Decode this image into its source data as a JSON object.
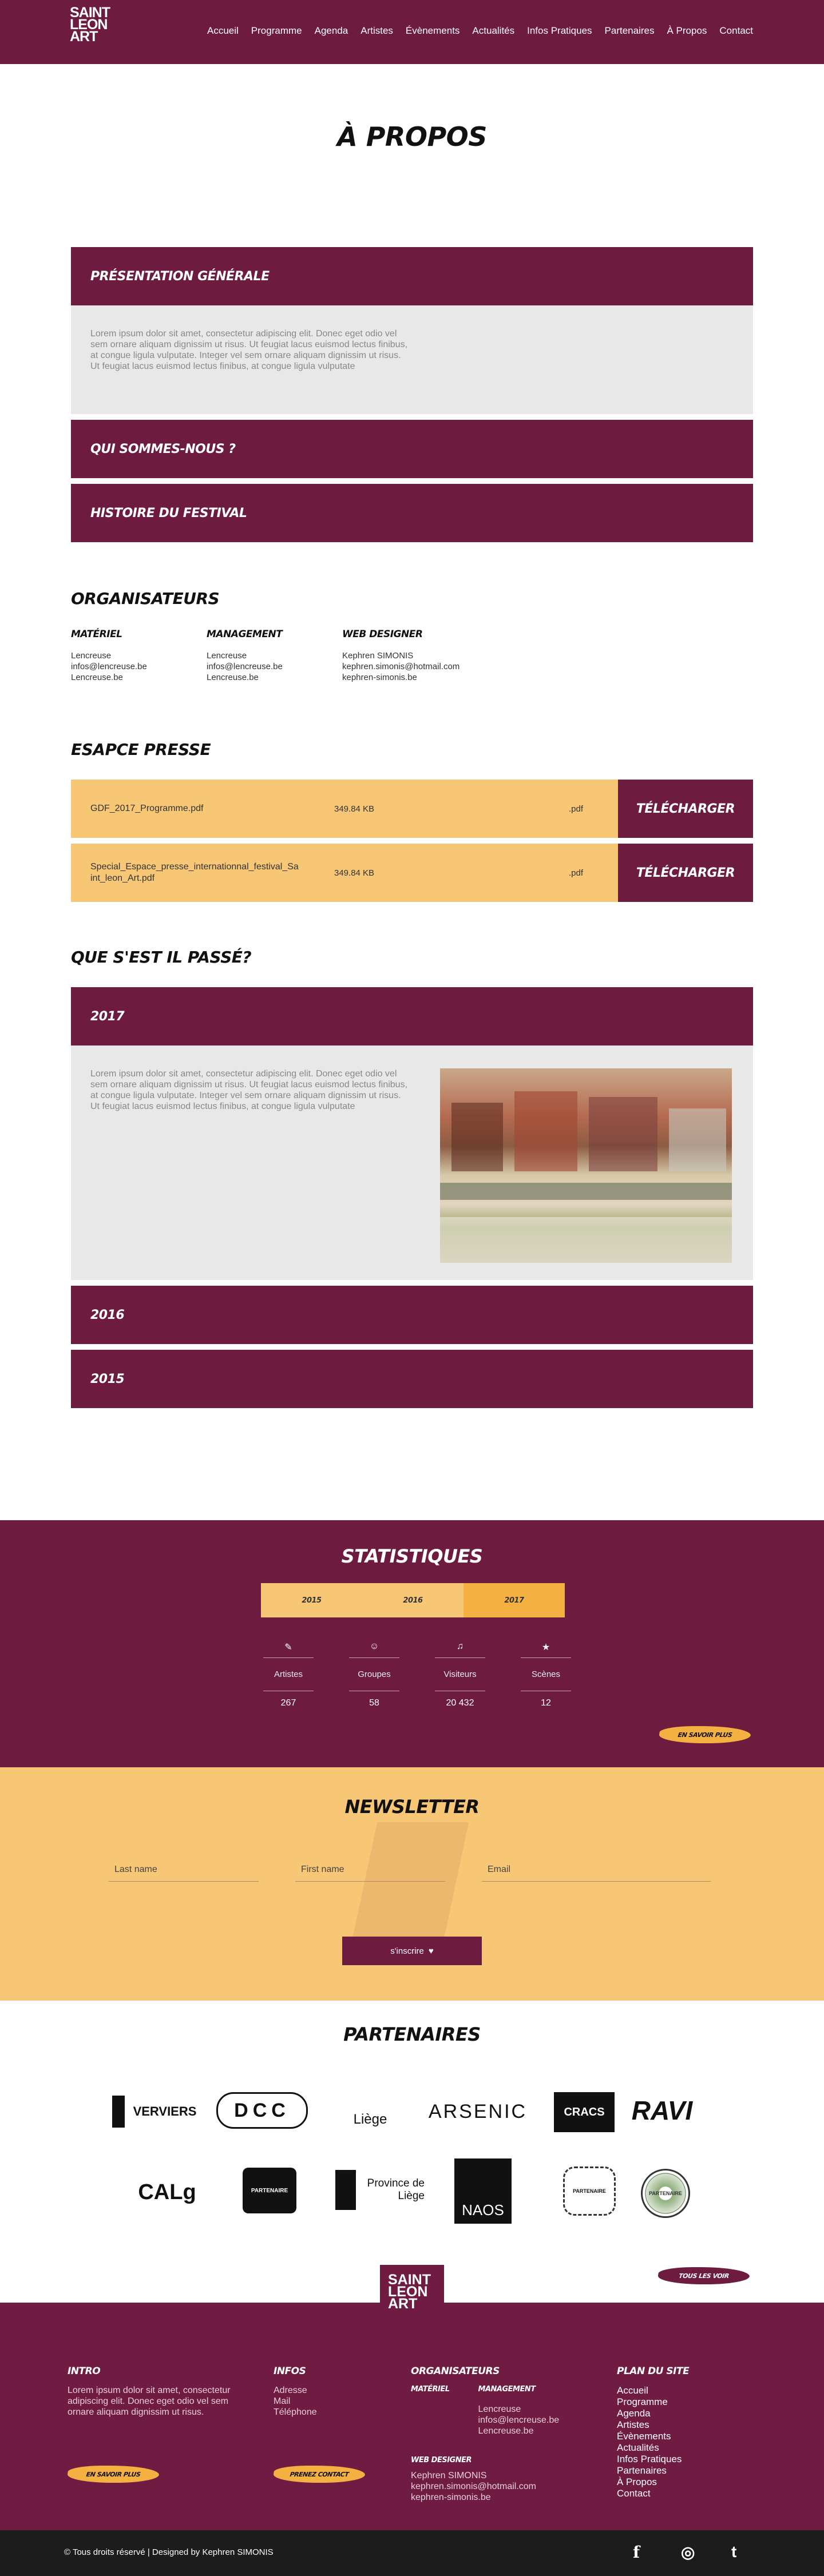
{
  "brand": {
    "logo_lines": [
      "SAINT",
      "LEON",
      "ART"
    ]
  },
  "nav": [
    "Accueil",
    "Programme",
    "Agenda",
    "Artistes",
    "Évènements",
    "Actualités",
    "Infos Pratiques",
    "Partenaires",
    "À Propos",
    "Contact"
  ],
  "page_title": "À PROPOS",
  "about": {
    "sections": [
      "PRÉSENTATION GÉNÉRALE",
      "QUI SOMMES-NOUS ?",
      "HISTOIRE DU FESTIVAL"
    ],
    "lorem": "Lorem ipsum dolor sit amet, consectetur adipiscing elit. Donec eget odio vel sem ornare aliquam dignissim ut risus. Ut feugiat lacus euismod lectus finibus, at congue ligula vulputate. Integer vel sem ornare aliquam dignissim ut risus. Ut feugiat lacus euismod lectus finibus, at congue ligula vulputate"
  },
  "organisers": {
    "title": "ORGANISATEURS",
    "cols": [
      {
        "head": "MATÉRIEL",
        "lines": [
          "Lencreuse",
          "infos@lencreuse.be",
          "Lencreuse.be"
        ]
      },
      {
        "head": "MANAGEMENT",
        "lines": [
          "Lencreuse",
          "infos@lencreuse.be",
          "Lencreuse.be"
        ]
      },
      {
        "head": "WEB DESIGNER",
        "lines": [
          "Kephren SIMONIS",
          "kephren.simonis@hotmail.com",
          "kephren-simonis.be"
        ]
      }
    ]
  },
  "press": {
    "title": "ESAPCE PRESSE",
    "files": [
      {
        "name": "GDF_2017_Programme.pdf",
        "size": "349.84 KB",
        "ext": ".pdf",
        "button": "TÉLÉCHARGER"
      },
      {
        "name": "Special_Espace_presse_internationnal_festival_Saint_leon_Art.pdf",
        "size": "349.84 KB",
        "ext": ".pdf",
        "button": "TÉLÉCHARGER"
      }
    ]
  },
  "past": {
    "title": "QUE S'EST IL PASSÉ?",
    "years": [
      "2017",
      "2016",
      "2015"
    ],
    "lorem": "Lorem ipsum dolor sit amet, consectetur adipiscing elit. Donec eget odio vel sem ornare aliquam dignissim ut risus. Ut feugiat lacus euismod lectus finibus, at congue ligula vulputate. Integer vel sem ornare aliquam dignissim ut risus. Ut feugiat lacus euismod lectus finibus, at congue ligula vulputate"
  },
  "stats": {
    "title": "STATISTIQUES",
    "tabs": [
      "2015",
      "2016",
      "2017"
    ],
    "active_tab": "2017",
    "items": [
      {
        "label": "Artistes",
        "value": "267",
        "icon": "brush-icon"
      },
      {
        "label": "Groupes",
        "value": "58",
        "icon": "group-icon"
      },
      {
        "label": "Visiteurs",
        "value": "20 432",
        "icon": "visitors-icon"
      },
      {
        "label": "Scènes",
        "value": "12",
        "icon": "stage-icon"
      }
    ],
    "more": "EN SAVOIR PLUS"
  },
  "newsletter": {
    "title": "NEWSLETTER",
    "fields": [
      "Last name",
      "First name",
      "Email"
    ],
    "submit": "s'inscrire"
  },
  "partners": {
    "title": "PARTENAIRES",
    "logos": [
      "VERVIERS",
      "DCC",
      "Liège",
      "ARSENIC",
      "CRACS",
      "RAVI",
      "CALg",
      "PARTENAIRE",
      "Province de Liège",
      "NAOS",
      "PARTENAIRE",
      "PARTENAIRE"
    ],
    "all": "TOUS LES VOIR"
  },
  "footer": {
    "intro_title": "INTRO",
    "intro_text": "Lorem ipsum dolor sit amet, consectetur adipiscing elit. Donec eget odio vel sem ornare aliquam dignissim ut risus.",
    "intro_btn": "EN SAVOIR PLUS",
    "infos_title": "INFOS",
    "infos": [
      "Adresse",
      "Mail",
      "Téléphone"
    ],
    "infos_btn": "PRENEZ CONTACT",
    "orga_title": "ORGANISATEURS",
    "materiel": "MATÉRIEL",
    "management": "MANAGEMENT",
    "management_lines": [
      "Lencreuse",
      "infos@lencreuse.be",
      "Lencreuse.be"
    ],
    "webdesigner": "WEB DESIGNER",
    "web_lines": [
      "Kephren SIMONIS",
      "kephren.simonis@hotmail.com",
      "kephren-simonis.be"
    ],
    "plan_title": "PLAN DU SITE",
    "plan": [
      "Accueil",
      "Programme",
      "Agenda",
      "Artistes",
      "Évènements",
      "Actualités",
      "Infos Pratiques",
      "Partenaires",
      "À Propos",
      "Contact"
    ],
    "copyright": "© Tous droits réservé | Designed by Kephren SIMONIS",
    "social": [
      "f",
      "◎",
      "t"
    ]
  }
}
